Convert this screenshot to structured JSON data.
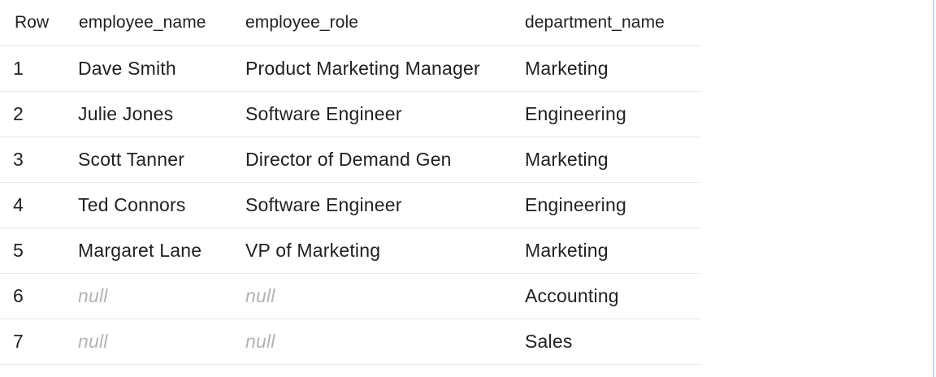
{
  "table": {
    "columns": [
      "Row",
      "employee_name",
      "employee_role",
      "department_name"
    ],
    "rows": [
      {
        "row": "1",
        "employee_name": "Dave Smith",
        "employee_role": "Product Marketing Manager",
        "department_name": "Marketing"
      },
      {
        "row": "2",
        "employee_name": "Julie Jones",
        "employee_role": "Software Engineer",
        "department_name": "Engineering"
      },
      {
        "row": "3",
        "employee_name": "Scott Tanner",
        "employee_role": "Director of Demand Gen",
        "department_name": "Marketing"
      },
      {
        "row": "4",
        "employee_name": "Ted Connors",
        "employee_role": "Software Engineer",
        "department_name": "Engineering"
      },
      {
        "row": "5",
        "employee_name": "Margaret Lane",
        "employee_role": "VP of Marketing",
        "department_name": "Marketing"
      },
      {
        "row": "6",
        "employee_name": "null",
        "employee_role": "null",
        "department_name": "Accounting"
      },
      {
        "row": "7",
        "employee_name": "null",
        "employee_role": "null",
        "department_name": "Sales"
      }
    ]
  },
  "colors": {
    "text": "#202124",
    "null_text": "#b4b4b4",
    "row_divider": "#e8e8e8",
    "frame_border": "#c9d7ee"
  }
}
